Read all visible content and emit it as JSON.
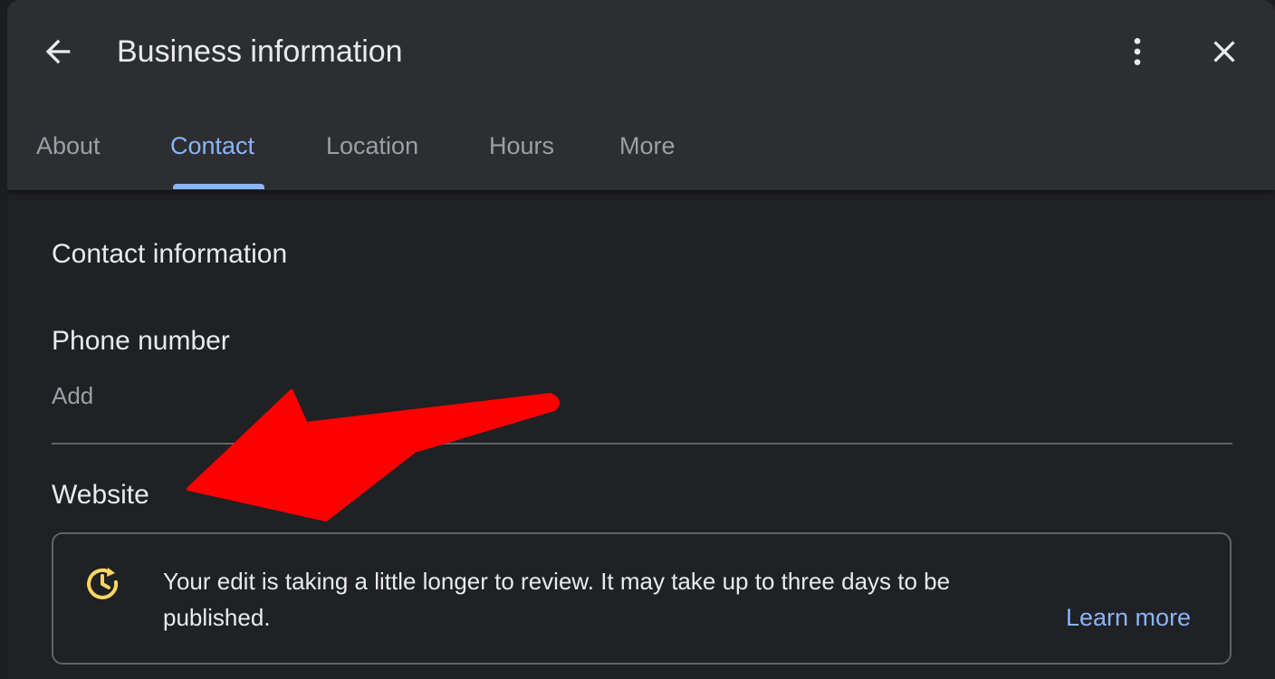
{
  "header": {
    "title": "Business information",
    "back_icon": "arrow-back-icon",
    "menu_icon": "more-vert-icon",
    "close_icon": "close-icon"
  },
  "tabs": [
    {
      "label": "About",
      "active": false
    },
    {
      "label": "Contact",
      "active": true
    },
    {
      "label": "Location",
      "active": false
    },
    {
      "label": "Hours",
      "active": false
    },
    {
      "label": "More",
      "active": false
    }
  ],
  "content": {
    "section_title": "Contact information",
    "phone": {
      "label": "Phone number",
      "action": "Add"
    },
    "website": {
      "label": "Website"
    },
    "notice": {
      "icon": "clock-review-icon",
      "text": "Your edit is taking a little longer to review. It may take up to three days to be published.",
      "link": "Learn more"
    }
  },
  "annotation": {
    "type": "arrow",
    "color": "#ff0000"
  },
  "colors": {
    "accent": "#8ab4f8",
    "notice_icon": "#fdd663",
    "background": "#202124",
    "header": "#2d2e31"
  }
}
